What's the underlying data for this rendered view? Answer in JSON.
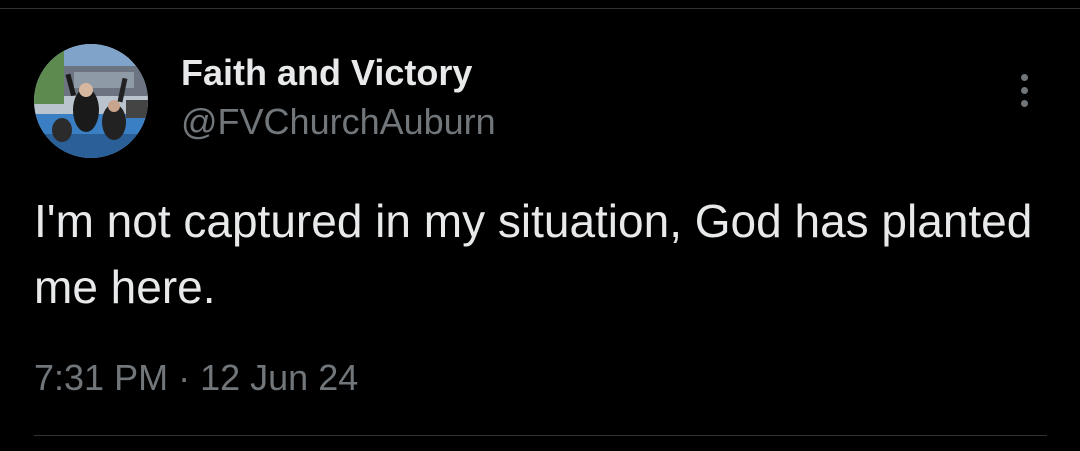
{
  "colors": {
    "background": "#000000",
    "primary_text": "#e7e9ea",
    "secondary_text": "#71767b",
    "divider": "#2f3336"
  },
  "author": {
    "display_name": "Faith and Victory",
    "handle": "@FVChurchAuburn",
    "avatar_icon": "profile-photo"
  },
  "more_menu": {
    "icon": "more-vertical-icon"
  },
  "tweet": {
    "text": "I'm not captured in my situation, God has planted me here.",
    "time": "7:31 PM",
    "separator": "·",
    "date": "12 Jun 24"
  }
}
